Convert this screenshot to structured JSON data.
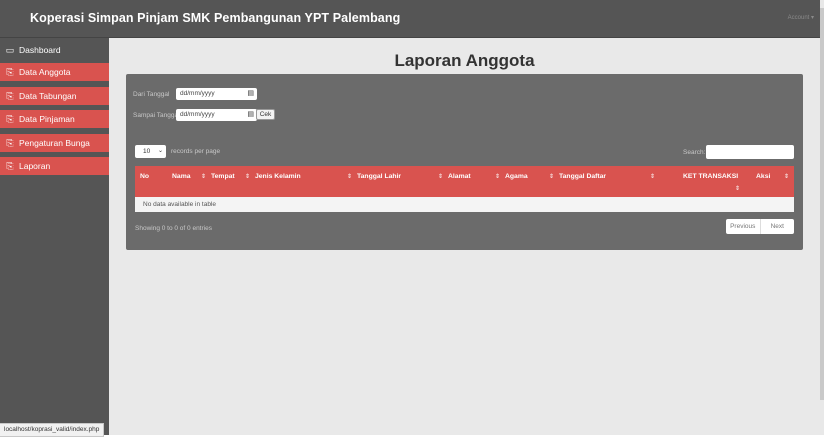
{
  "topbar": {
    "brand": "Koperasi Simpan Pinjam SMK Pembangunan YPT Palembang",
    "account_label": "Account ▾"
  },
  "sidebar": {
    "items": [
      {
        "label": "Dashboard",
        "icon": "monitor-icon",
        "glyph": "▭",
        "active": false
      },
      {
        "label": "Data Anggota",
        "icon": "copy-icon",
        "glyph": "⎘",
        "active": true
      },
      {
        "label": "Data Tabungan",
        "icon": "copy-icon",
        "glyph": "⎘",
        "active": true
      },
      {
        "label": "Data Pinjaman",
        "icon": "copy-icon",
        "glyph": "⎘",
        "active": true
      },
      {
        "label": "Pengaturan Bunga",
        "icon": "copy-icon",
        "glyph": "⎘",
        "active": true
      },
      {
        "label": "Laporan",
        "icon": "copy-icon",
        "glyph": "⎘",
        "active": true
      }
    ]
  },
  "status_url": "localhost/koprasi_valid/index.php",
  "main": {
    "title": "Laporan Anggota",
    "filter": {
      "from_label": "Dari Tanggal",
      "from_placeholder": "dd/mm/yyyy",
      "to_label": "Sampai Tanggal",
      "to_placeholder": "dd/mm/yyyy",
      "button_label": "Cek"
    },
    "table": {
      "length_value": "10",
      "length_suffix": "records per page",
      "search_label": "Search:",
      "columns": [
        "No",
        "Nama",
        "Tempat",
        "Jenis Kelamin",
        "Tanggal Lahir",
        "Alamat",
        "Agama",
        "Tanggal Daftar",
        "KET TRANSAKSI",
        "Aksi"
      ],
      "sort_glyph": "⇕",
      "empty_message": "No data available in table",
      "info": "Showing 0 to 0 of 0 entries",
      "previous_label": "Previous",
      "next_label": "Next"
    }
  },
  "colors": {
    "topbar": "#555555",
    "sidebar": "#555555",
    "accent_red": "#d9534f",
    "panel": "#6b6b6b",
    "background": "#e9e9e9"
  }
}
